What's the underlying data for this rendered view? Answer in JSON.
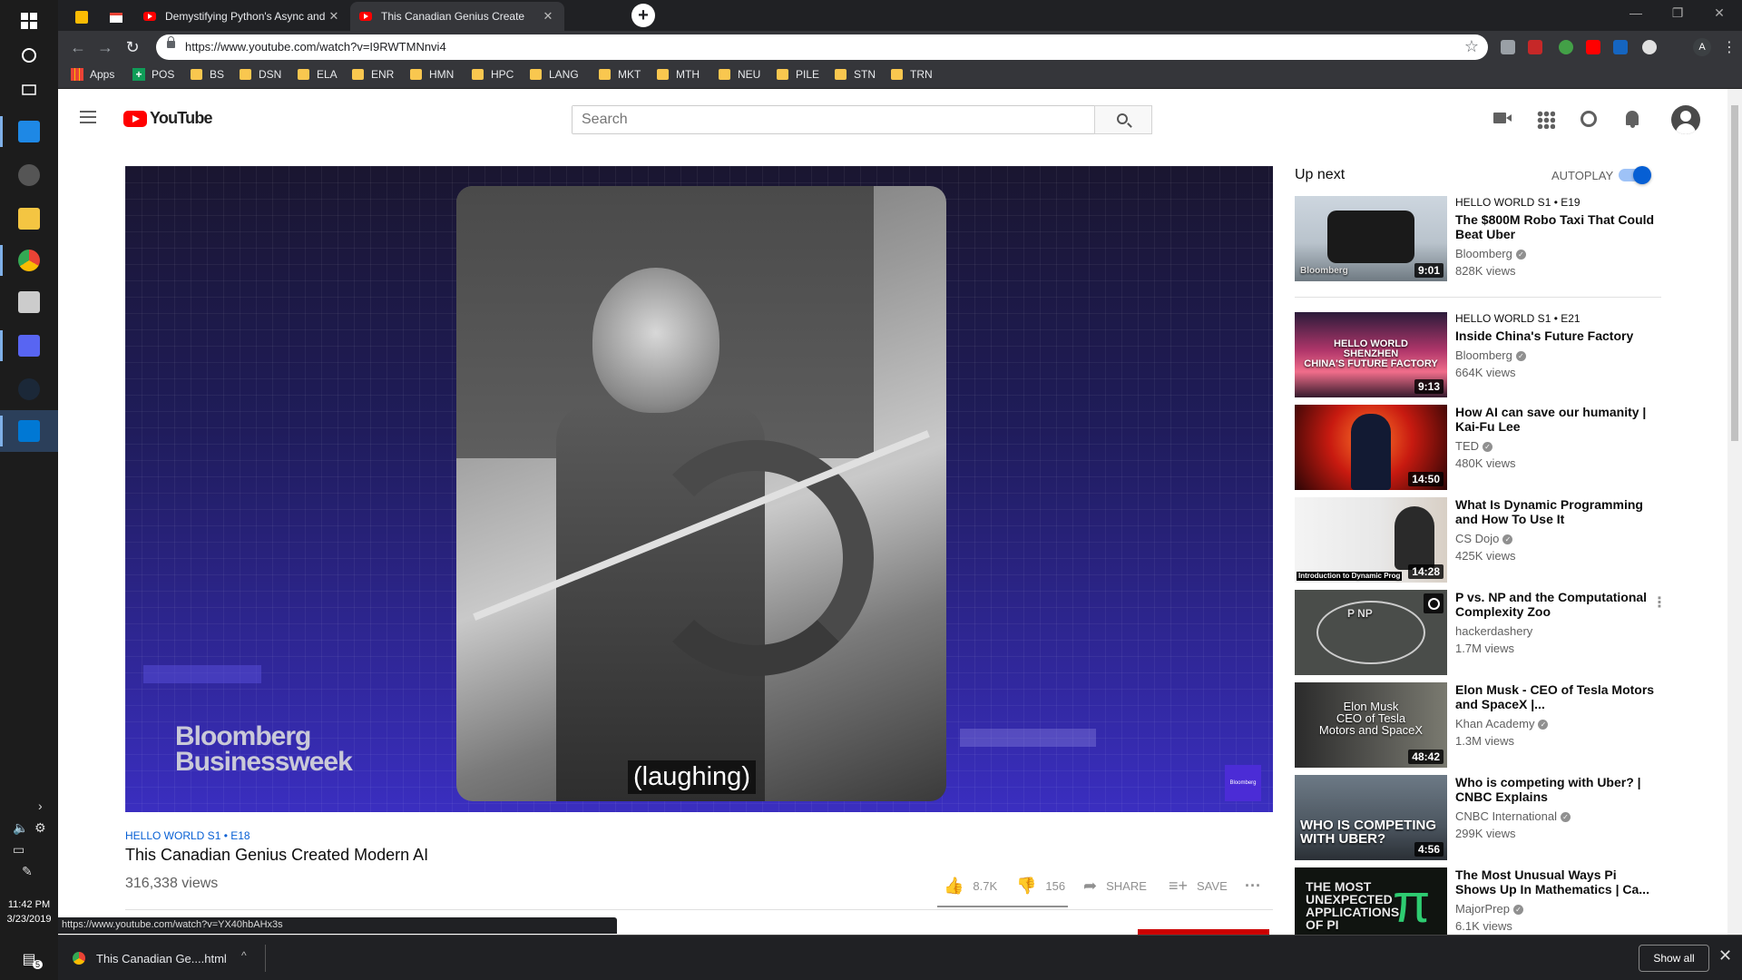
{
  "taskbar": {
    "time": "11:42 PM",
    "date": "3/23/2019",
    "notification_count": "5"
  },
  "browser": {
    "tabs": [
      {
        "title": "Demystifying Python's Async and"
      },
      {
        "title": "This Canadian Genius Create"
      }
    ],
    "url": "https://www.youtube.com/watch?v=I9RWTMNnvi4",
    "profile_initial": "A",
    "bookmarks": [
      "Apps",
      "POS",
      "BS",
      "DSN",
      "ELA",
      "ENR",
      "HMN",
      "HPC",
      "LANG",
      "MKT",
      "MTH",
      "NEU",
      "PILE",
      "STN",
      "TRN"
    ],
    "status_url": "https://www.youtube.com/watch?v=YX40hbAHx3s"
  },
  "youtube": {
    "logo_text": "YouTube",
    "search_placeholder": "Search"
  },
  "video": {
    "overlay_logo": "Bloomberg\nBusinessweek",
    "caption": "(laughing)",
    "corner_badge": "Bloomberg",
    "series_tag": "HELLO WORLD  S1 • E18",
    "title": "This Canadian Genius Created Modern AI",
    "views": "316,338 views",
    "likes": "8.7K",
    "dislikes": "156",
    "share_label": "SHARE",
    "save_label": "SAVE"
  },
  "sidebar": {
    "up_next_label": "Up next",
    "autoplay_label": "AUTOPLAY",
    "autoplay_on": true,
    "recommendations": [
      {
        "series": "HELLO WORLD  S1 • E19",
        "title": "The $800M Robo Taxi That Could Beat Uber",
        "channel": "Bloomberg",
        "verified": true,
        "views": "828K views",
        "duration": "9:01",
        "thumb_text": "Bloomberg"
      },
      {
        "series": "HELLO WORLD  S1 • E21",
        "title": "Inside China's Future Factory",
        "channel": "Bloomberg",
        "verified": true,
        "views": "664K views",
        "duration": "9:13",
        "thumb_text": "HELLO WORLD\nSHENZHEN\nCHINA'S FUTURE FACTORY"
      },
      {
        "series": "",
        "title": "How AI can save our humanity | Kai-Fu Lee",
        "channel": "TED",
        "verified": true,
        "views": "480K views",
        "duration": "14:50",
        "thumb_text": ""
      },
      {
        "series": "",
        "title": "What Is Dynamic Programming and How To Use It",
        "channel": "CS Dojo",
        "verified": true,
        "views": "425K views",
        "duration": "14:28",
        "thumb_text": "Introduction to Dynamic Prog"
      },
      {
        "series": "",
        "title": "P vs. NP and the Computational Complexity Zoo",
        "channel": "hackerdashery",
        "verified": false,
        "views": "1.7M views",
        "duration": "",
        "thumb_text": "P   NP"
      },
      {
        "series": "",
        "title": "Elon Musk - CEO of Tesla Motors and SpaceX |...",
        "channel": "Khan Academy",
        "verified": true,
        "views": "1.3M views",
        "duration": "48:42",
        "thumb_text": "Elon Musk\nCEO of Tesla\nMotors and SpaceX"
      },
      {
        "series": "",
        "title": "Who is competing with Uber? | CNBC Explains",
        "channel": "CNBC International",
        "verified": true,
        "views": "299K views",
        "duration": "4:56",
        "thumb_text": "WHO IS COMPETING\nWITH UBER?"
      },
      {
        "series": "",
        "title": "The Most Unusual Ways Pi Shows Up In Mathematics | Ca...",
        "channel": "MajorPrep",
        "verified": true,
        "views": "6.1K views",
        "duration": "",
        "thumb_text": "THE MOST\nUNEXPECTED\nAPPLICATIONS\nOF PI"
      }
    ]
  },
  "downloads": {
    "file_name": "This Canadian Ge....html",
    "show_all_label": "Show all"
  }
}
